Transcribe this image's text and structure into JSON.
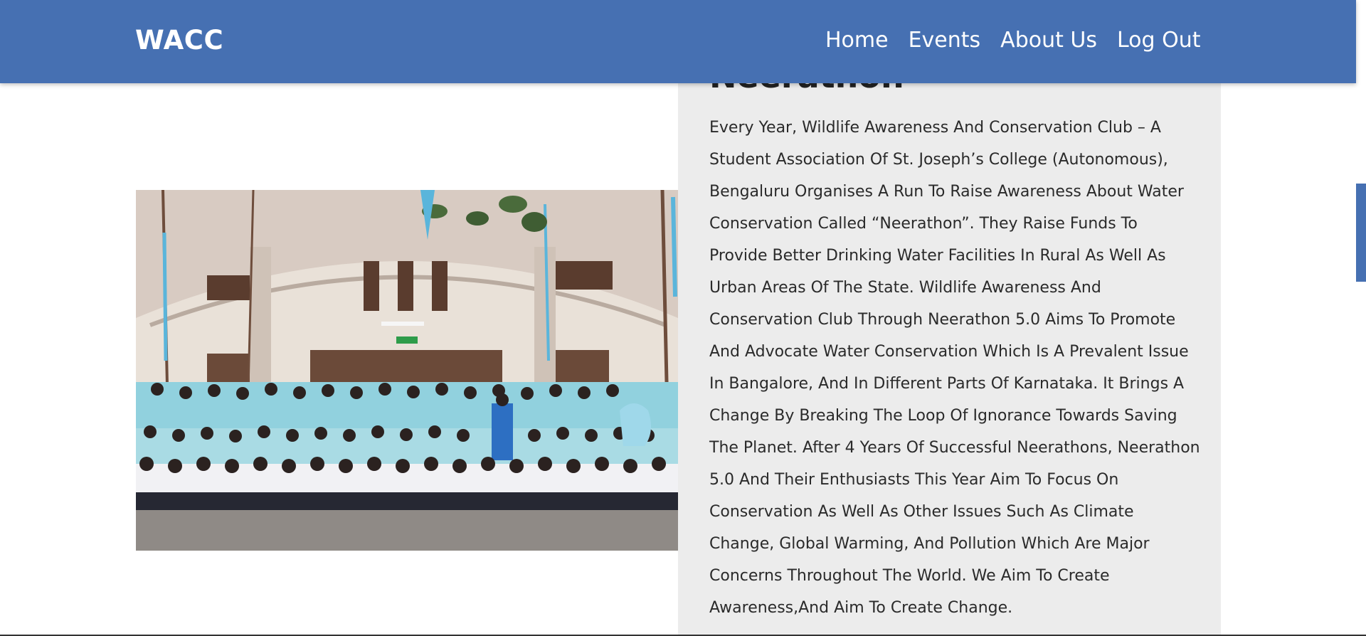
{
  "header": {
    "brand": "WACC",
    "nav": [
      {
        "label": "Home"
      },
      {
        "label": "Events"
      },
      {
        "label": "About Us"
      },
      {
        "label": "Log Out"
      }
    ]
  },
  "event": {
    "title": "Neerathon",
    "description": "Every Year, Wildlife Awareness And Conservation Club – A Student Association Of St. Joseph’s College (Autonomous), Bengaluru Organises A Run To Raise Awareness About Water Conservation Called “Neerathon”. They Raise Funds To Provide Better Drinking Water Facilities In Rural As Well As Urban Areas Of The State. Wildlife Awareness And Conservation Club Through Neerathon 5.0 Aims To Promote And Advocate Water Conservation Which Is A Prevalent Issue In Bangalore, And In Different Parts Of Karnataka. It Brings A Change By Breaking The Loop Of Ignorance Towards Saving The Planet. After 4 Years Of Successful Neerathons, Neerathon 5.0 And Their Enthusiasts This Year Aim To Focus On Conservation As Well As Other Issues Such As Climate Change, Global Warming, And Pollution Which Are Major Concerns Throughout The World. We Aim To Create Awareness,And Aim To Create Change."
  },
  "colors": {
    "navbar": "#4670b2",
    "panel": "#ececec",
    "shirt_light": "#8fd3e0",
    "shirt_white": "#f4f4f6"
  }
}
